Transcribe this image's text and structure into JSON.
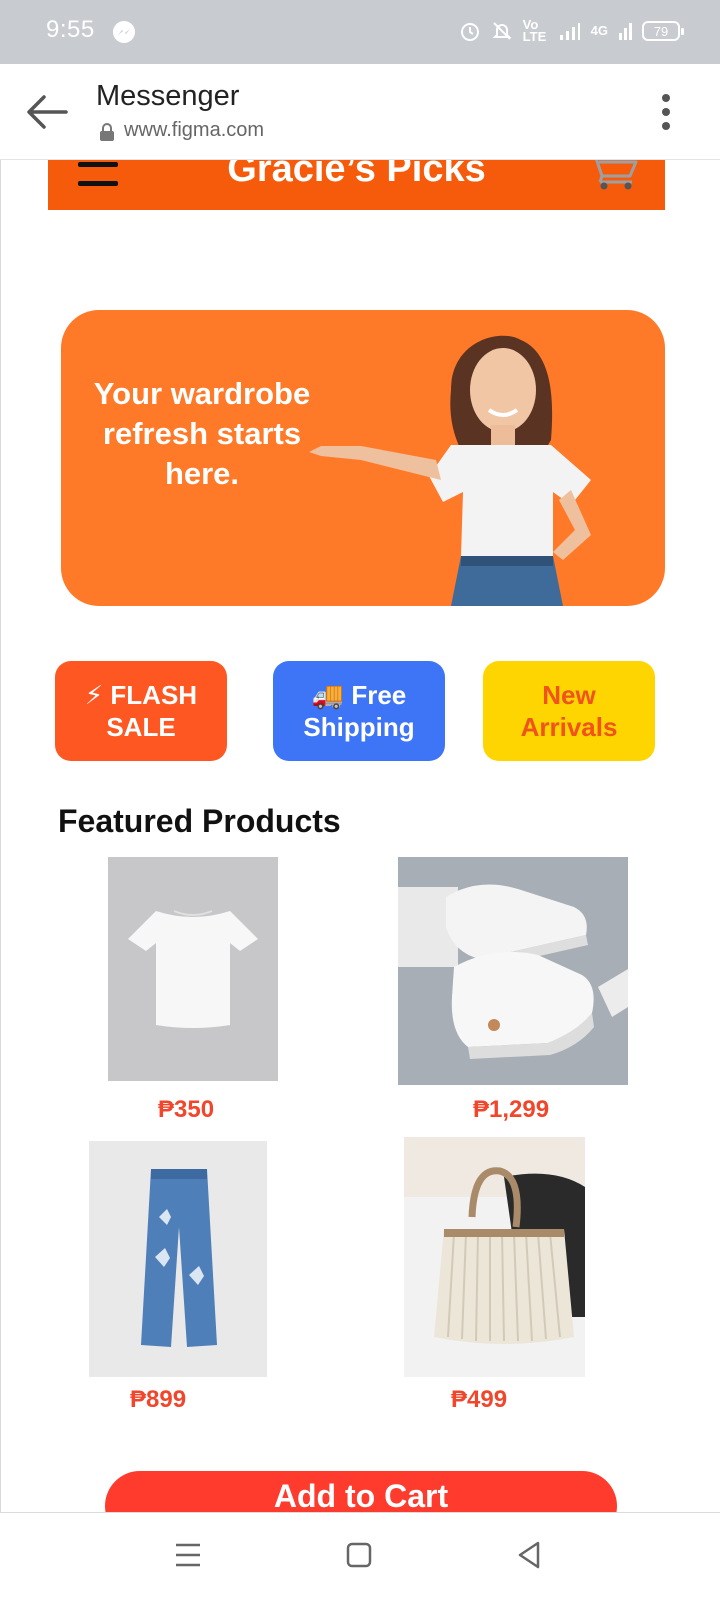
{
  "status": {
    "time": "9:55",
    "volte": "Vo LTE",
    "network": "4G",
    "battery": "79"
  },
  "browser": {
    "title": "Messenger",
    "url": "www.figma.com"
  },
  "shop": {
    "title": "Gracie’s Picks",
    "hero_text": "Your wardrobe refresh starts here.",
    "pills": {
      "flash": "⚡ FLASH SALE",
      "shipping": "🚚 Free Shipping",
      "new_arrivals": "New Arrivals"
    },
    "featured_title": "Featured Products",
    "products": [
      {
        "name": "white-crop-tee",
        "price": "₱350"
      },
      {
        "name": "white-sneakers",
        "price": "₱1,299"
      },
      {
        "name": "butterfly-jeans",
        "price": "₱899"
      },
      {
        "name": "striped-tote-bag",
        "price": "₱499"
      }
    ],
    "cta": "Add to Cart"
  },
  "colors": {
    "brand_orange": "#f55b0a",
    "hero_orange": "#ff7a28",
    "flash_red": "#ff5722",
    "ship_blue": "#3e74f6",
    "new_yellow": "#ffd500",
    "price_red": "#f2462c",
    "cta_red": "#ff3b2e"
  },
  "icons": [
    "messenger-icon",
    "alarm-icon",
    "mute-icon",
    "signal-icon",
    "battery-icon",
    "back-arrow-icon",
    "lock-icon",
    "more-vert-icon",
    "hamburger-icon",
    "cart-icon",
    "menu-nav-icon",
    "home-nav-icon",
    "back-nav-icon"
  ]
}
